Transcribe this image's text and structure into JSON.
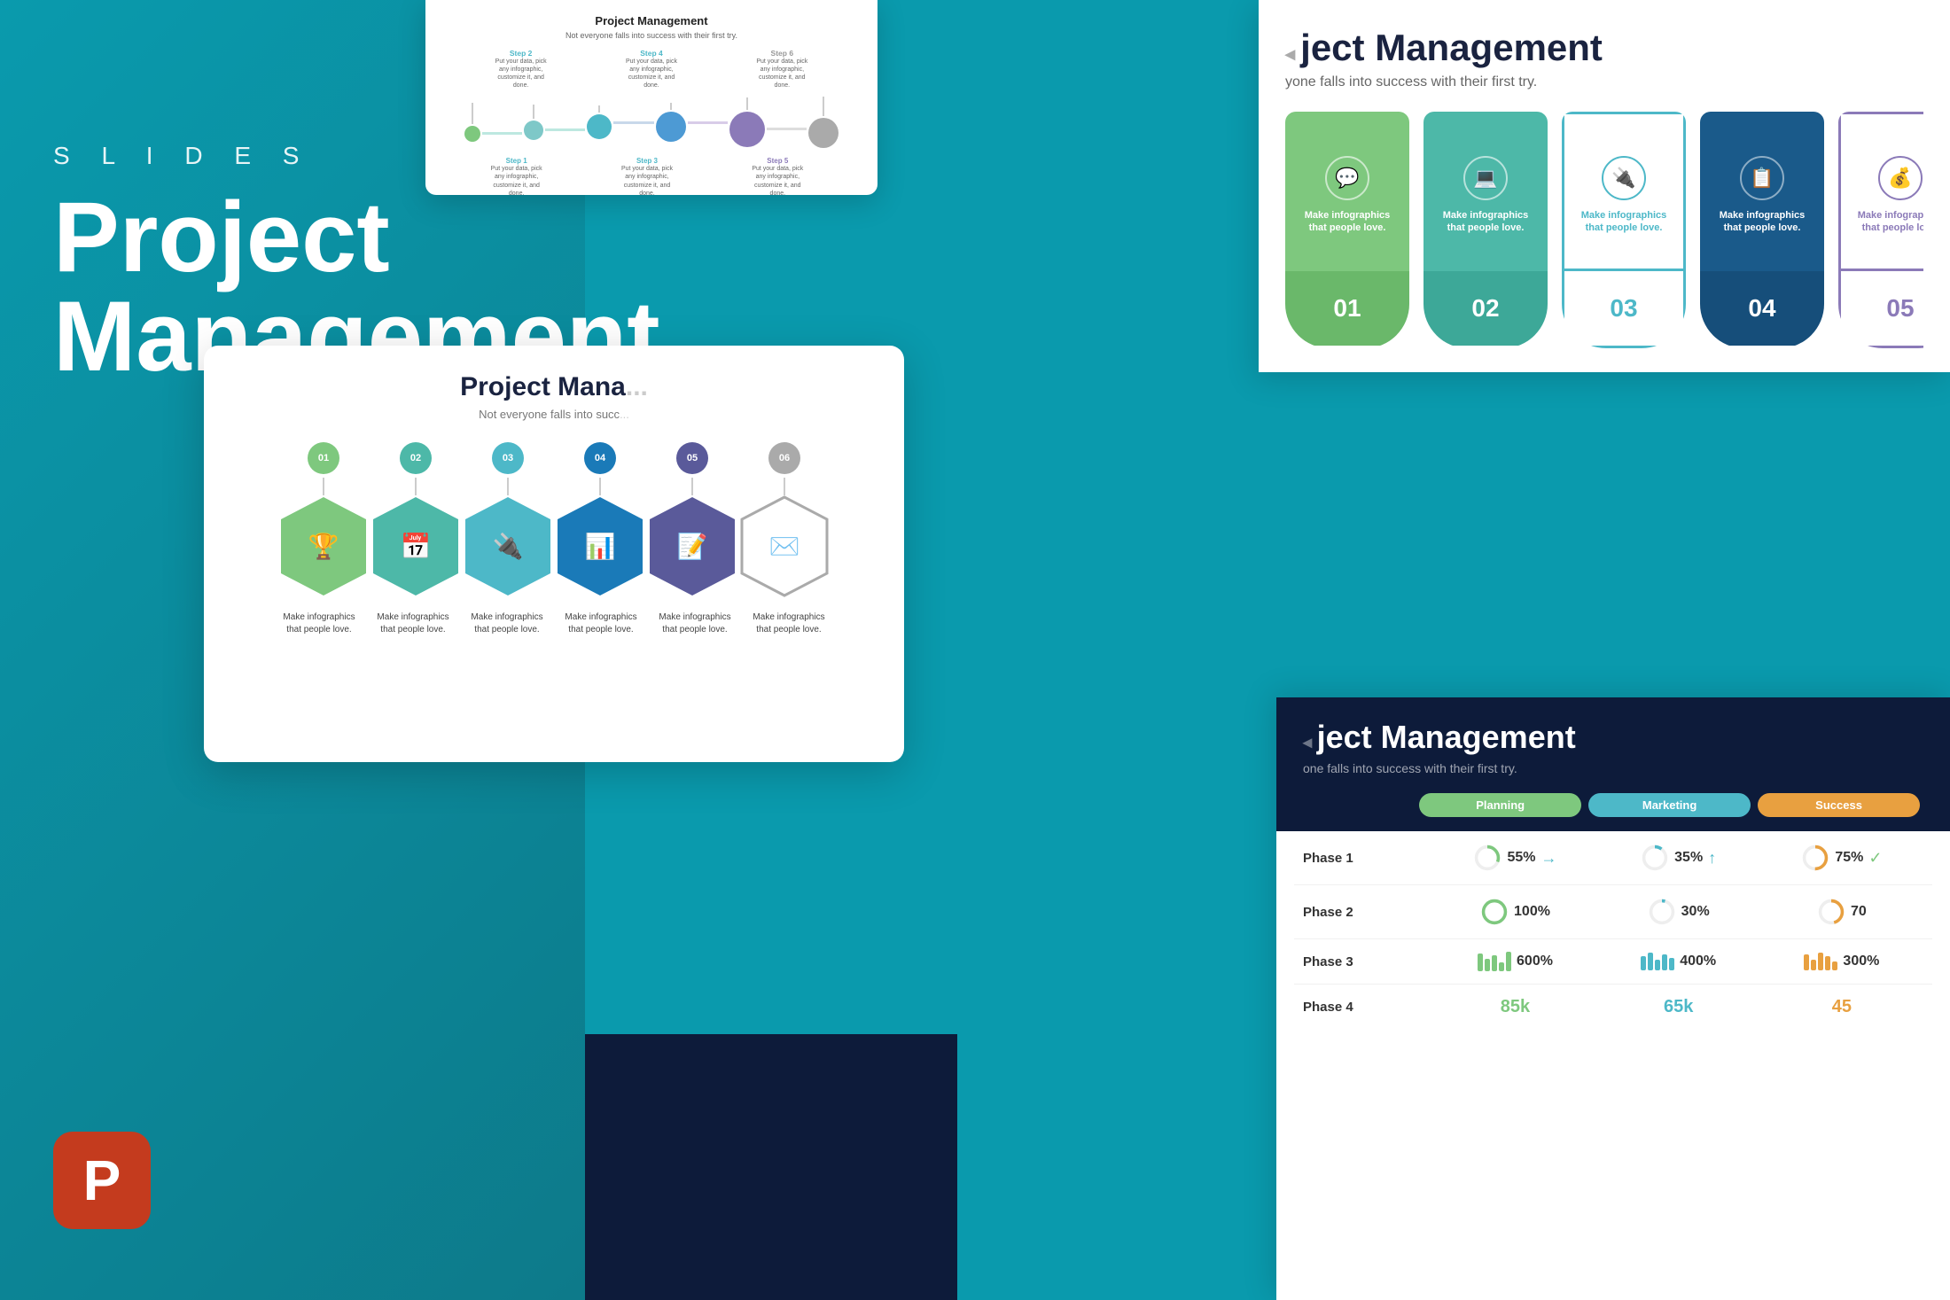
{
  "background": {
    "color": "#0a9aad"
  },
  "left_panel": {
    "slides_label": "S L I D E S",
    "title_line1": "Project",
    "title_line2": "Management"
  },
  "slide_top": {
    "title": "Project Management",
    "subtitle": "Not everyone falls into success with their first try.",
    "steps": [
      {
        "label": "Step 2",
        "desc": "Put your data, pick any infographic, customize it, and done.",
        "position": "top"
      },
      {
        "label": "Step 4",
        "desc": "Put your data, pick any infographic, customize it, and done.",
        "position": "top"
      },
      {
        "label": "Step 6",
        "desc": "Put your data, pick any infographic, customize it, and done.",
        "position": "top"
      },
      {
        "label": "Step 1",
        "desc": "Put your data, pick any infographic, customize it, and done.",
        "position": "bottom"
      },
      {
        "label": "Step 3",
        "desc": "Put your data, pick any infographic, customize it, and done.",
        "position": "bottom"
      },
      {
        "label": "Step 5",
        "desc": "Put your data, pick any infographic, customize it, and done.",
        "position": "bottom"
      }
    ]
  },
  "slide_right_top": {
    "title": "ject Management",
    "subtitle": "yone falls into success with their first try.",
    "cards": [
      {
        "number": "01",
        "text": "Make infographics that people love.",
        "color": "green1",
        "icon": "💬"
      },
      {
        "number": "02",
        "text": "Make infographics that people love.",
        "color": "green2",
        "icon": "💻"
      },
      {
        "number": "03",
        "text": "Make infographics that people love.",
        "color": "teal",
        "icon": "🔌"
      },
      {
        "number": "04",
        "text": "Make infographics that people love.",
        "color": "blue",
        "icon": "📋"
      },
      {
        "number": "05",
        "text": "Make infographics that people love.",
        "color": "purple",
        "icon": "💰"
      }
    ]
  },
  "slide_center": {
    "title": "Project Mana",
    "subtitle": "Not everyone falls into succ",
    "hexagons": [
      {
        "id": "01",
        "color": "h1",
        "icon": "🏆",
        "label": "Make infographics that people love."
      },
      {
        "id": "02",
        "color": "h2",
        "icon": "📅",
        "label": "Make infographics that people love."
      },
      {
        "id": "03",
        "color": "h3",
        "icon": "🔌",
        "label": "Make infographics that people love."
      },
      {
        "id": "04",
        "color": "h4",
        "icon": "📊",
        "label": "Make infographics that people love."
      },
      {
        "id": "05",
        "color": "h5",
        "icon": "📝",
        "label": "Make infographics that people love."
      },
      {
        "id": "06",
        "color": "h6",
        "icon": "✉️",
        "label": "Make infographics that people love."
      }
    ]
  },
  "slide_right_bottom": {
    "header_title": "ject Management",
    "header_subtitle": "one falls into success with their first try.",
    "columns": [
      "",
      "Planning",
      "Marketing",
      "Success"
    ],
    "rows": [
      {
        "phase": "Phase 1",
        "planning_pct": "55%",
        "planning_arrow": "→",
        "marketing_pct": "35%",
        "marketing_arrow": "↑",
        "success_pct": "75%",
        "success_arrow": "✓"
      },
      {
        "phase": "Phase 2",
        "planning_pct": "100%",
        "marketing_pct": "30%",
        "success_pct": "70"
      },
      {
        "phase": "Phase 3",
        "planning_pct": "600%",
        "marketing_pct": "400%",
        "success_pct": "300%"
      },
      {
        "phase": "Phase 4",
        "planning_pct": "85k",
        "marketing_pct": "65k",
        "success_pct": "45"
      }
    ]
  }
}
